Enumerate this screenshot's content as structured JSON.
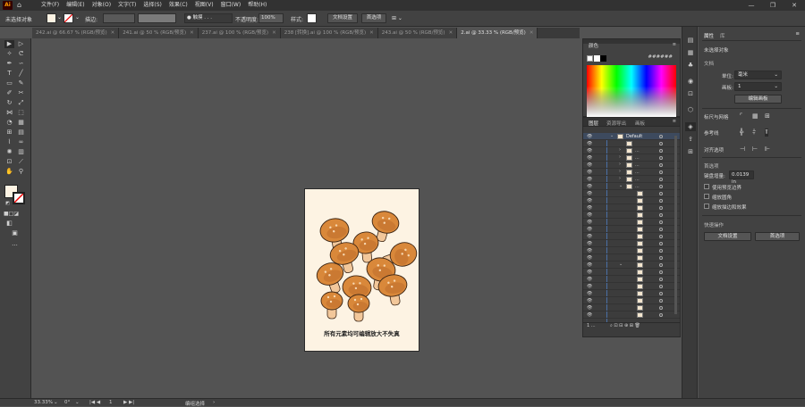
{
  "app": {
    "logo": "Ai",
    "home_icon": "home-icon"
  },
  "menus": [
    "文件(F)",
    "编辑(E)",
    "对象(O)",
    "文字(T)",
    "选择(S)",
    "效果(C)",
    "视图(V)",
    "窗口(W)",
    "帮助(H)"
  ],
  "window_controls": {
    "minimize": "—",
    "restore": "❐",
    "close": "✕"
  },
  "control_bar": {
    "selection_label": "未选择对象",
    "stroke_label": "描边:",
    "brush_label": "● 触摸 . . .",
    "opacity_label": "不透明度:",
    "opacity_value": "100%",
    "style_label": "样式:",
    "doc_setup_button": "文档设置",
    "prefs_button": "首选项"
  },
  "tabs": [
    {
      "label": "242.ai @ 66.67 % (RGB/预览)",
      "close": "✕",
      "active": false
    },
    {
      "label": "241.ai @ 50 % (RGB/预览)",
      "close": "✕",
      "active": false
    },
    {
      "label": "237.ai @ 100 % (RGB/预览)",
      "close": "✕",
      "active": false
    },
    {
      "label": "238 [转换].ai @ 100 % (RGB/预览)",
      "close": "✕",
      "active": false
    },
    {
      "label": "243.ai @ 50 % (RGB/预览)",
      "close": "✕",
      "active": false
    },
    {
      "label": "2.ai @ 33.33 % (RGB/预览)",
      "close": "✕",
      "active": true
    }
  ],
  "artboard": {
    "caption": "所有元素均可编辑放大不失真"
  },
  "status_bar": {
    "zoom": "33.33%",
    "rotation": "0°",
    "page": "1",
    "tool": "编组选择"
  },
  "color_panel": {
    "title": "颜色",
    "hex_hint": "######"
  },
  "layers_panel": {
    "tabs": [
      "图层",
      "资源导出",
      "画板"
    ],
    "top_layer": "Default",
    "row_count": 26
  },
  "properties": {
    "tabs": [
      "属性",
      "库"
    ],
    "no_selection": "未选择对象",
    "document_header": "文档",
    "unit_label": "单位:",
    "unit_value": "毫米",
    "artboard_label": "画板:",
    "artboard_value": "1",
    "edit_artboard_button": "编辑画板",
    "ruler_grid": "标尺与网格",
    "guides": "参考线",
    "snap": "对齐选项",
    "prefs_header": "首选项",
    "keyboard_increment_label": "键盘增量:",
    "keyboard_increment_value": "0.0139 in",
    "preview_bounds": "使用预览边界",
    "scale_corners": "缩放圆角",
    "scale_strokes": "缩放描边和效果",
    "quick_actions": "快速操作",
    "doc_setup_button": "文档设置",
    "prefs_button": "首选项"
  },
  "colors": {
    "artboard_bg": "#fdf3e3",
    "mushroom_cap": "#d9883a",
    "mushroom_cap_dark": "#b8692a",
    "mushroom_stem": "#f2c79a",
    "outline": "#3a2414",
    "layer_highlight": "#4a6fa5"
  }
}
